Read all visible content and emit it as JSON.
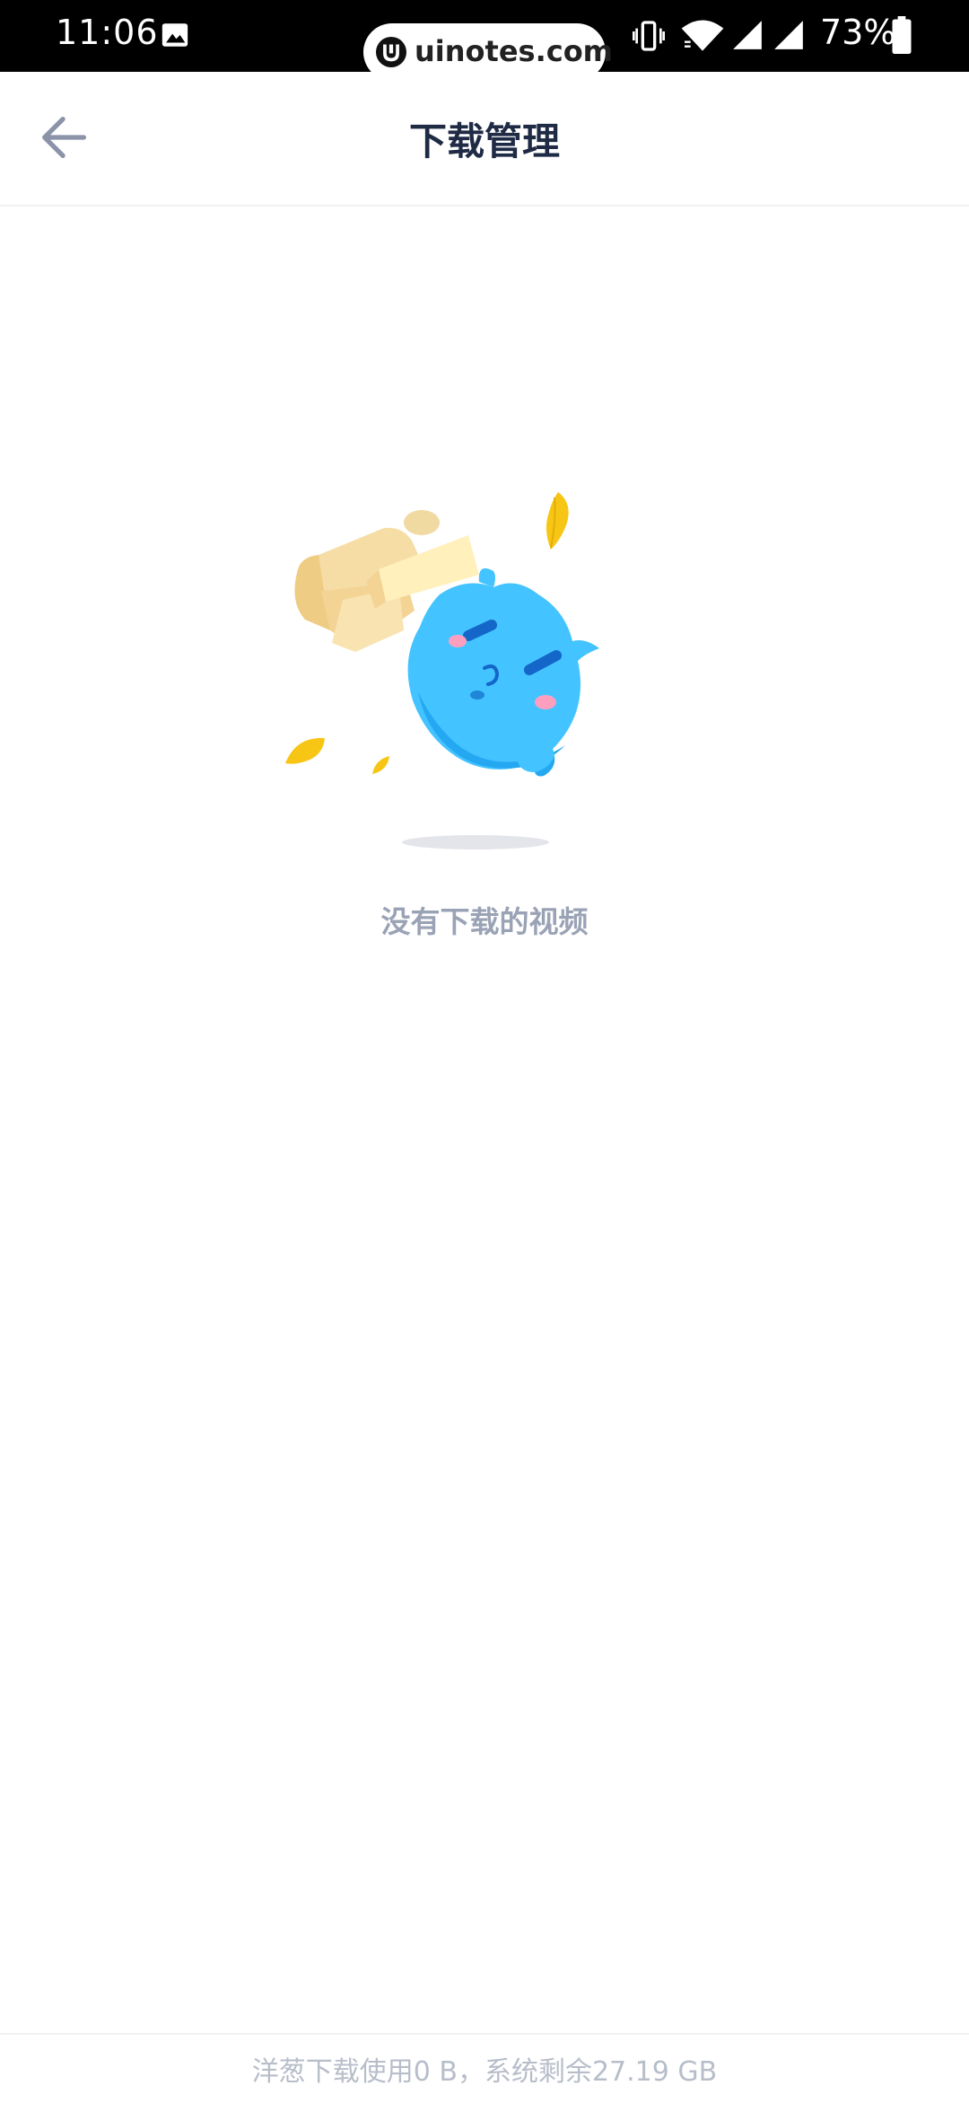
{
  "status_bar": {
    "time": "11:06",
    "battery_percent": "73%",
    "icons": [
      "gallery-icon",
      "vibrate-icon",
      "wifi-icon",
      "signal-icon",
      "signal-icon",
      "battery-icon"
    ]
  },
  "watermark": {
    "text": "uinotes.com"
  },
  "header": {
    "title": "下载管理",
    "back_icon": "arrow-left-icon"
  },
  "empty_state": {
    "message": "没有下载的视频",
    "illustration": "blue-mascot-with-box"
  },
  "footer": {
    "storage_text": "洋葱下载使用0 B，系统剩余27.19 GB"
  },
  "colors": {
    "title": "#1f2a44",
    "muted": "#9aa3b5",
    "mascot": "#3fc0ff",
    "box": "#f3d79a"
  }
}
